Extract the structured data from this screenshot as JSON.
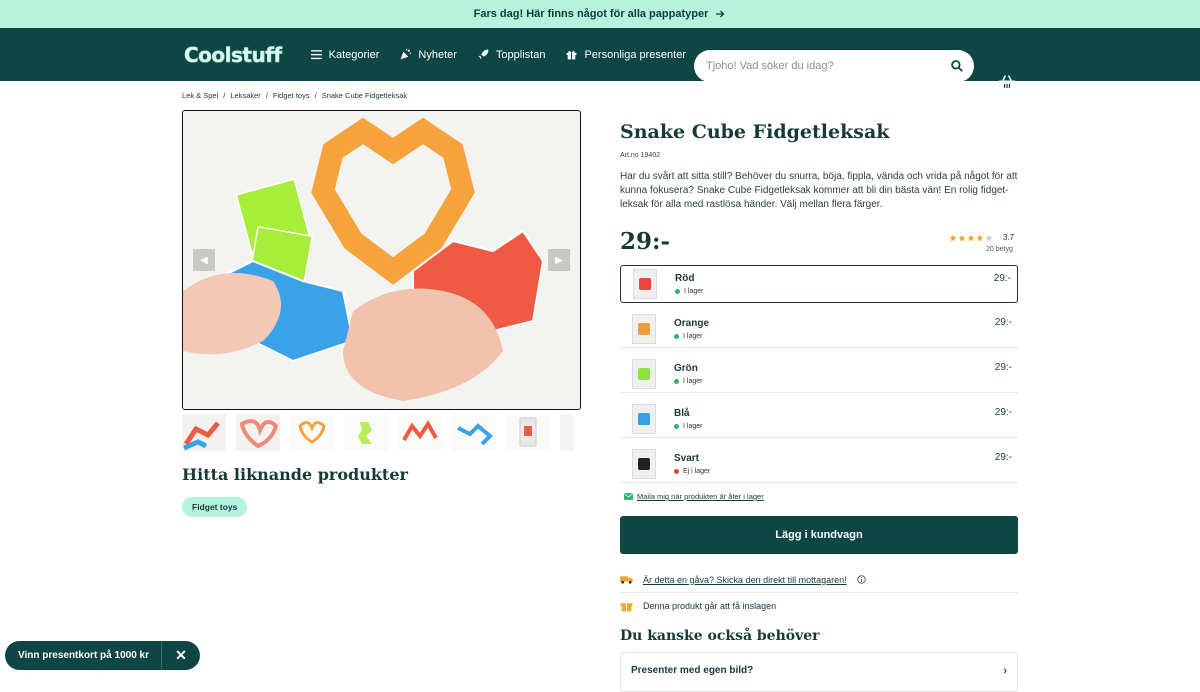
{
  "promo": {
    "text": "Fars dag! Här finns något för alla pappatyper"
  },
  "header": {
    "logo": "Coolstuff",
    "nav": [
      "Kategorier",
      "Nyheter",
      "Topplistan",
      "Personliga presenter"
    ],
    "search_placeholder": "Tjoho! Vad söker du idag?"
  },
  "breadcrumb": [
    "Lek & Spel",
    "Leksaker",
    "Fidget toys",
    "Snake Cube Fidgetleksak"
  ],
  "similar": {
    "title": "Hitta liknande produkter",
    "tag": "Fidget toys"
  },
  "product": {
    "title": "Snake Cube Fidgetleksak",
    "artno": "Art.no 19402",
    "description": "Har du svårt att sitta still? Behöver du snurra, böja, fippla, vända och vrida på något för att kunna fokusera? Snake Cube Fidgetleksak kommer att bli din bästa vän! En rolig fidget-leksak för alla med rastlösa händer. Välj mellan flera färger.",
    "price": "29:-",
    "rating": "3.7",
    "rating_count": "20 betyg",
    "variants": [
      {
        "name": "Röd",
        "stock": "I lager",
        "price": "29:-",
        "color": "#e8453c",
        "in_stock": true
      },
      {
        "name": "Orange",
        "stock": "I lager",
        "price": "29:-",
        "color": "#f39a3c",
        "in_stock": true
      },
      {
        "name": "Grön",
        "stock": "I lager",
        "price": "29:-",
        "color": "#8fe23a",
        "in_stock": true
      },
      {
        "name": "Blå",
        "stock": "I lager",
        "price": "29:-",
        "color": "#3a9fe2",
        "in_stock": true
      },
      {
        "name": "Svart",
        "stock": "Ej i lager",
        "price": "29:-",
        "color": "#222222",
        "in_stock": false
      }
    ],
    "notify": "Maila mig när produkten är åter i lager",
    "add_to_cart": "Lägg i kundvagn",
    "gift_link": "Är detta en gåva? Skicka den direkt till mottagaren!",
    "wrap_text": "Denna produkt går att få inslagen"
  },
  "also_need": {
    "title": "Du kanske också behöver",
    "item": "Presenter med egen bild?"
  },
  "giftcard": {
    "label": "Vinn presentkort på 1000 kr"
  },
  "colors": {
    "primary": "#0e4646",
    "mint": "#b5f3dc",
    "in_stock": "#2fb36b",
    "out_stock": "#e0453c"
  }
}
